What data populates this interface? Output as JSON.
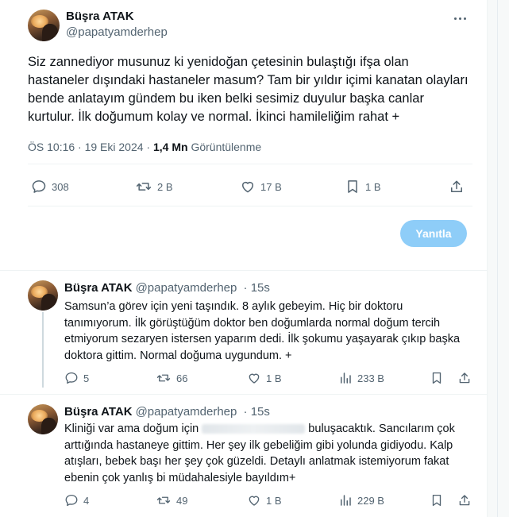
{
  "main": {
    "name": "Büşra ATAK",
    "handle": "@papatyamderhep",
    "text": "Siz zannediyor musunuz ki yenidoğan çetesinin bulaştığı ifşa olan hastaneler dışındaki hastaneler masum? Tam bir yıldır içimi kanatan olayları bende anlatayım gündem bu iken belki sesimiz duyulur başka canlar kurtulur. İlk doğumum kolay ve normal. İkinci hamileliğim rahat +",
    "time": "ÖS 10:16 · 19 Eki 2024 · ",
    "views_count": "1,4 Mn",
    "views_label": " Görüntülenme",
    "replies": "308",
    "reposts": "2 B",
    "likes": "17 B",
    "bookmarks": "1 B",
    "reply_button": "Yanıtla"
  },
  "replies": [
    {
      "name": "Büşra ATAK",
      "handle": "@papatyamderhep",
      "time": "· 15s",
      "text": "Samsun’a görev için yeni taşındık. 8 aylık gebeyim. Hiç bir doktoru tanımıyorum. İlk görüştüğüm doktor ben doğumlarda normal doğum tercih etmiyorum sezaryen istersen yaparım dedi. İlk şokumu yaşayarak çıkıp başka doktora gittim. Normal doğuma uygundum. +",
      "replies": "5",
      "reposts": "66",
      "likes": "1 B",
      "views": "233 B"
    },
    {
      "name": "Büşra ATAK",
      "handle": "@papatyamderhep",
      "time": "· 15s",
      "text_before": "Kliniği var ama doğum için ",
      "text_after": " buluşacaktık. Sancılarım çok arttığında hastaneye gittim. Her şey ilk gebeliğim gibi yolunda gidiyodu. Kalp atışları, bebek başı her şey çok güzeldi. Detaylı anlatmak istemiyorum fakat ebenin çok yanlış bi müdahalesiyle bayıldım+",
      "replies": "4",
      "reposts": "49",
      "likes": "1 B",
      "views": "229 B"
    }
  ],
  "colors": {
    "text": "#0f1419",
    "secondary": "#536471",
    "reply_button_bg": "#8ecdf8",
    "border": "#eff3f4"
  },
  "icons": [
    "reply-icon",
    "repost-icon",
    "like-icon",
    "bookmark-icon",
    "share-icon",
    "views-icon",
    "more-icon"
  ]
}
